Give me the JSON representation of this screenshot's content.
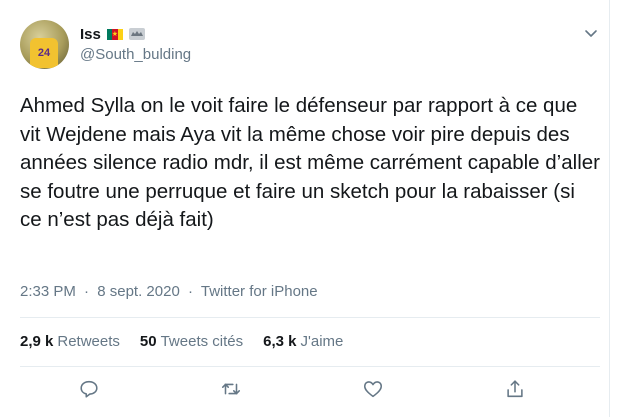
{
  "user": {
    "display_name": "Iss",
    "handle": "@South_bulding",
    "avatar_jersey_number": "24",
    "flag_star": "★",
    "icons": [
      "cameroon-flag-icon",
      "bat-signal-icon",
      "chevron-down-icon"
    ]
  },
  "tweet": {
    "text": "Ahmed Sylla on le voit faire le défenseur par rapport à ce que vit Wejdene mais Aya vit la même chose voir pire depuis des années silence radio mdr, il est même carrément capable d’aller se foutre une perruque et faire un sketch pour la rabaisser (si ce n’est pas déjà fait)"
  },
  "meta": {
    "time": "2:33 PM",
    "sep1": "·",
    "date": "8 sept. 2020",
    "sep2": "·",
    "source": "Twitter for iPhone"
  },
  "stats": {
    "retweets_count": "2,9 k",
    "retweets_label": "Retweets",
    "quotes_count": "50",
    "quotes_label": "Tweets cités",
    "likes_count": "6,3 k",
    "likes_label": "J'aime"
  },
  "actions": [
    "reply-icon",
    "retweet-icon",
    "like-icon",
    "share-icon"
  ],
  "colors": {
    "text": "#14171a",
    "secondary": "#657786",
    "divider": "#e6ecf0",
    "icon": "#657786"
  }
}
